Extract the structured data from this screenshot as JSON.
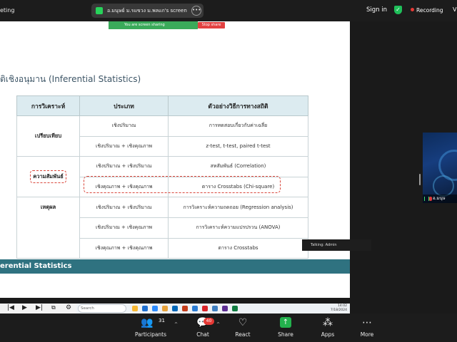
{
  "topbar": {
    "app_title": "eting",
    "share_pill_text": "อ.มนุษย์ ม.รแขวง ม.พลแก's screen",
    "sign_in": "Sign in",
    "recording": "Recording",
    "view": "V"
  },
  "sharing_bar": {
    "message": "You are screen sharing",
    "stop": "Stop share"
  },
  "slide": {
    "title": "ติเชิงอนุมาน (Inferential Statistics)",
    "table": {
      "headers": [
        "การวิเคราะห์",
        "ประเภท",
        "ตัวอย่างวิธีการทางสถิติ"
      ],
      "groups": [
        {
          "analysis": "เปรียบเทียบ",
          "rows": [
            {
              "type": "เชิงปริมาณ",
              "method": "การทดสอบเกี่ยวกับค่าเฉลี่ย"
            },
            {
              "type": "เชิงปริมาณ + เชิงคุณภาพ",
              "method": "z-test, t-test, paired t-test"
            }
          ]
        },
        {
          "analysis": "ความสัมพันธ์",
          "rows": [
            {
              "type": "เชิงปริมาณ + เชิงปริมาณ",
              "method": "สหสัมพันธ์ (Correlation)"
            },
            {
              "type": "เชิงคุณภาพ + เชิงคุณภาพ",
              "method": "ตาราง Crosstabs (Chi-square)"
            }
          ]
        },
        {
          "analysis": "เหตุผล",
          "rows": [
            {
              "type": "เชิงปริมาณ + เชิงปริมาณ",
              "method": "การวิเคราะห์ความถดถอย (Regression analysis)"
            },
            {
              "type": "เชิงปริมาณ + เชิงคุณภาพ",
              "method": "การวิเคราะห์ความแปรปรวน (ANOVA)"
            },
            {
              "type": "เชิงคุณภาพ + เชิงคุณภาพ",
              "method": "ตาราง Crosstabs"
            }
          ]
        }
      ]
    },
    "ribbon": "erential Statistics"
  },
  "talking": "Talking: Admin",
  "taskbar": {
    "search": "Search",
    "time": "14:02",
    "date": "7/18/2024"
  },
  "participant": {
    "name": "อ.มนุษ"
  },
  "toolbar": {
    "participants": {
      "label": "Participants",
      "count": "31"
    },
    "chat": {
      "label": "Chat",
      "badge": "40"
    },
    "react": {
      "label": "React"
    },
    "share": {
      "label": "Share"
    },
    "apps": {
      "label": "Apps"
    },
    "more": {
      "label": "More"
    }
  }
}
